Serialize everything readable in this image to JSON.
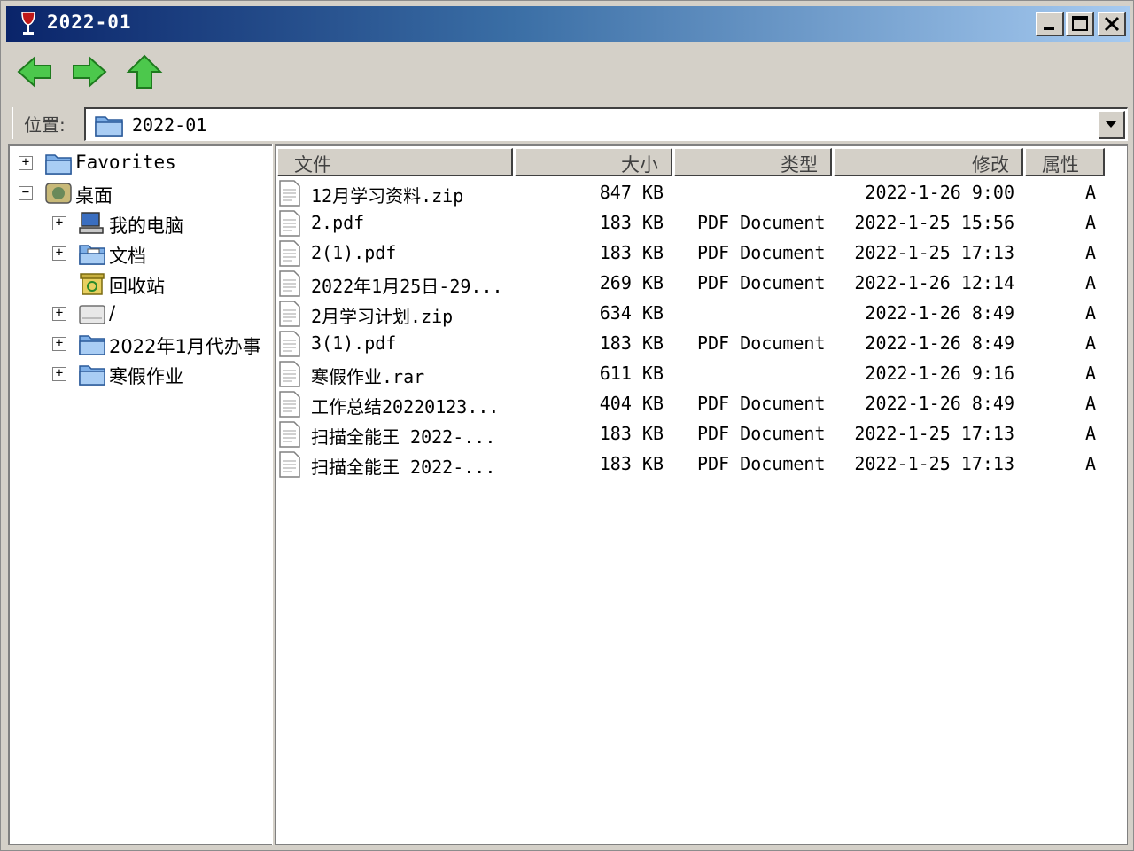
{
  "window": {
    "title": "2022-01",
    "controls": {
      "minimize": "minimize",
      "maximize": "maximize",
      "close": "close"
    }
  },
  "toolbar": {
    "back": "back-arrow-icon",
    "forward": "forward-arrow-icon",
    "up": "up-arrow-icon"
  },
  "location": {
    "label": "位置:",
    "value": "2022-01"
  },
  "tree": {
    "items": [
      {
        "toggle": "+",
        "label": "Favorites",
        "icon": "folder-icon"
      },
      {
        "toggle": "−",
        "label": "桌面",
        "icon": "desktop-icon"
      },
      {
        "toggle": "+",
        "label": "我的电脑",
        "icon": "computer-icon"
      },
      {
        "toggle": "+",
        "label": "文档",
        "icon": "documents-icon"
      },
      {
        "toggle": "",
        "label": "回收站",
        "icon": "recycle-bin-icon"
      },
      {
        "toggle": "+",
        "label": "/",
        "icon": "drive-icon"
      },
      {
        "toggle": "+",
        "label": "2022年1月代办事",
        "icon": "folder-icon"
      },
      {
        "toggle": "+",
        "label": "寒假作业",
        "icon": "folder-icon"
      }
    ]
  },
  "list": {
    "columns": {
      "name": "文件",
      "size": "大小",
      "type": "类型",
      "modified": "修改",
      "attr": "属性"
    },
    "rows": [
      {
        "name": "12月学习资料.zip",
        "size": "847 KB",
        "type": "",
        "modified": "2022-1-26 9:00",
        "attr": "A"
      },
      {
        "name": "2.pdf",
        "size": "183 KB",
        "type": "PDF Document",
        "modified": "2022-1-25 15:56",
        "attr": "A"
      },
      {
        "name": "2(1).pdf",
        "size": "183 KB",
        "type": "PDF Document",
        "modified": "2022-1-25 17:13",
        "attr": "A"
      },
      {
        "name": "2022年1月25日-29...",
        "size": "269 KB",
        "type": "PDF Document",
        "modified": "2022-1-26 12:14",
        "attr": "A"
      },
      {
        "name": "2月学习计划.zip",
        "size": "634 KB",
        "type": "",
        "modified": "2022-1-26 8:49",
        "attr": "A"
      },
      {
        "name": "3(1).pdf",
        "size": "183 KB",
        "type": "PDF Document",
        "modified": "2022-1-26 8:49",
        "attr": "A"
      },
      {
        "name": "寒假作业.rar",
        "size": "611 KB",
        "type": "",
        "modified": "2022-1-26 9:16",
        "attr": "A"
      },
      {
        "name": "工作总结20220123...",
        "size": "404 KB",
        "type": "PDF Document",
        "modified": "2022-1-26 8:49",
        "attr": "A"
      },
      {
        "name": "扫描全能王 2022-...",
        "size": "183 KB",
        "type": "PDF Document",
        "modified": "2022-1-25 17:13",
        "attr": "A"
      },
      {
        "name": "扫描全能王 2022-...",
        "size": "183 KB",
        "type": "PDF Document",
        "modified": "2022-1-25 17:13",
        "attr": "A"
      }
    ]
  },
  "colors": {
    "titlebar_start": "#0a246a",
    "titlebar_end": "#a6caf0",
    "nav_arrow": "#3cb83c",
    "folder": "#6aa0e0"
  }
}
